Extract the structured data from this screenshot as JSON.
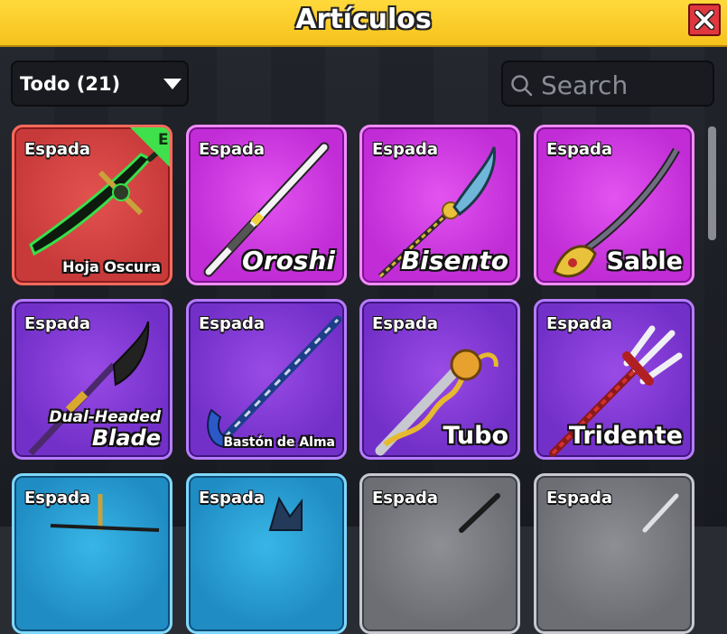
{
  "window": {
    "title": "Artículos"
  },
  "filter": {
    "selected": "Todo (21)"
  },
  "search": {
    "placeholder": "Search",
    "value": ""
  },
  "items": [
    {
      "category": "Espada",
      "name": "Hoja Oscura",
      "rarity_color": "#c83a3a",
      "badge": "E"
    },
    {
      "category": "Espada",
      "name": "Oroshi",
      "rarity_color": "#c12cd6"
    },
    {
      "category": "Espada",
      "name": "Bisento",
      "rarity_color": "#c12cd6"
    },
    {
      "category": "Espada",
      "name": "Sable",
      "rarity_color": "#c12cd6"
    },
    {
      "category": "Espada",
      "name_line1": "Dual-Headed",
      "name_line2": "Blade",
      "rarity_color": "#7330c9"
    },
    {
      "category": "Espada",
      "name": "Bastón de Alma",
      "rarity_color": "#7330c9"
    },
    {
      "category": "Espada",
      "name": "Tubo",
      "rarity_color": "#7330c9"
    },
    {
      "category": "Espada",
      "name": "Tridente",
      "rarity_color": "#7330c9"
    },
    {
      "category": "Espada",
      "rarity_color": "#1f8cc4"
    },
    {
      "category": "Espada",
      "rarity_color": "#1f8cc4"
    },
    {
      "category": "Espada",
      "rarity_color": "#6c6e74"
    },
    {
      "category": "Espada",
      "rarity_color": "#6c6e74"
    }
  ],
  "icons": {
    "close": "close-icon",
    "dropdown": "chevron-down-icon",
    "search": "search-icon"
  }
}
